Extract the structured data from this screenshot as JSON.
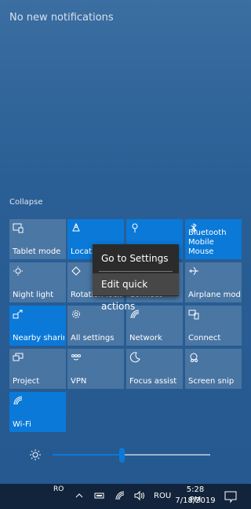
{
  "header": {
    "no_notifications": "No new notifications"
  },
  "collapse_label": "Collapse",
  "tiles": [
    {
      "label": "Tablet mode",
      "icon": "tablet-mode-icon",
      "on": false
    },
    {
      "label": "Location",
      "icon": "location-icon",
      "on": true
    },
    {
      "label": "",
      "icon": "focus-pin-icon",
      "on": true
    },
    {
      "label": "Bluetooth Mobile Mouse",
      "icon": "bluetooth-icon",
      "on": true
    },
    {
      "label": "Night light",
      "icon": "night-light-icon",
      "on": false
    },
    {
      "label": "Rotation lock",
      "icon": "rotation-lock-icon",
      "on": false
    },
    {
      "label": "Connect",
      "icon": "project-icon",
      "on": false
    },
    {
      "label": "Airplane mode",
      "icon": "airplane-icon",
      "on": false
    },
    {
      "label": "Nearby sharing",
      "icon": "nearby-sharing-icon",
      "on": true
    },
    {
      "label": "All settings",
      "icon": "settings-gear-icon",
      "on": false
    },
    {
      "label": "Network",
      "icon": "network-icon",
      "on": false
    },
    {
      "label": "Connect",
      "icon": "connect-icon",
      "on": false
    },
    {
      "label": "Project",
      "icon": "project-icon",
      "on": false
    },
    {
      "label": "VPN",
      "icon": "vpn-icon",
      "on": false
    },
    {
      "label": "Focus assist",
      "icon": "moon-icon",
      "on": false
    },
    {
      "label": "Screen snip",
      "icon": "screen-snip-icon",
      "on": false
    },
    {
      "label": "Wi-Fi",
      "icon": "wifi-icon",
      "on": true
    }
  ],
  "context_menu": {
    "go_to_settings": "Go to Settings",
    "edit_quick_actions": "Edit quick actions"
  },
  "brightness": {
    "level": 0.44
  },
  "taskbar": {
    "lang_small": "RO",
    "lang": "ROU",
    "time": "5:28 PM",
    "date": "7/18/2019"
  },
  "colors": {
    "accent": "#0b79d8",
    "tile_off": "rgba(255,255,255,0.16)",
    "menu_bg": "#2b2b2b"
  }
}
